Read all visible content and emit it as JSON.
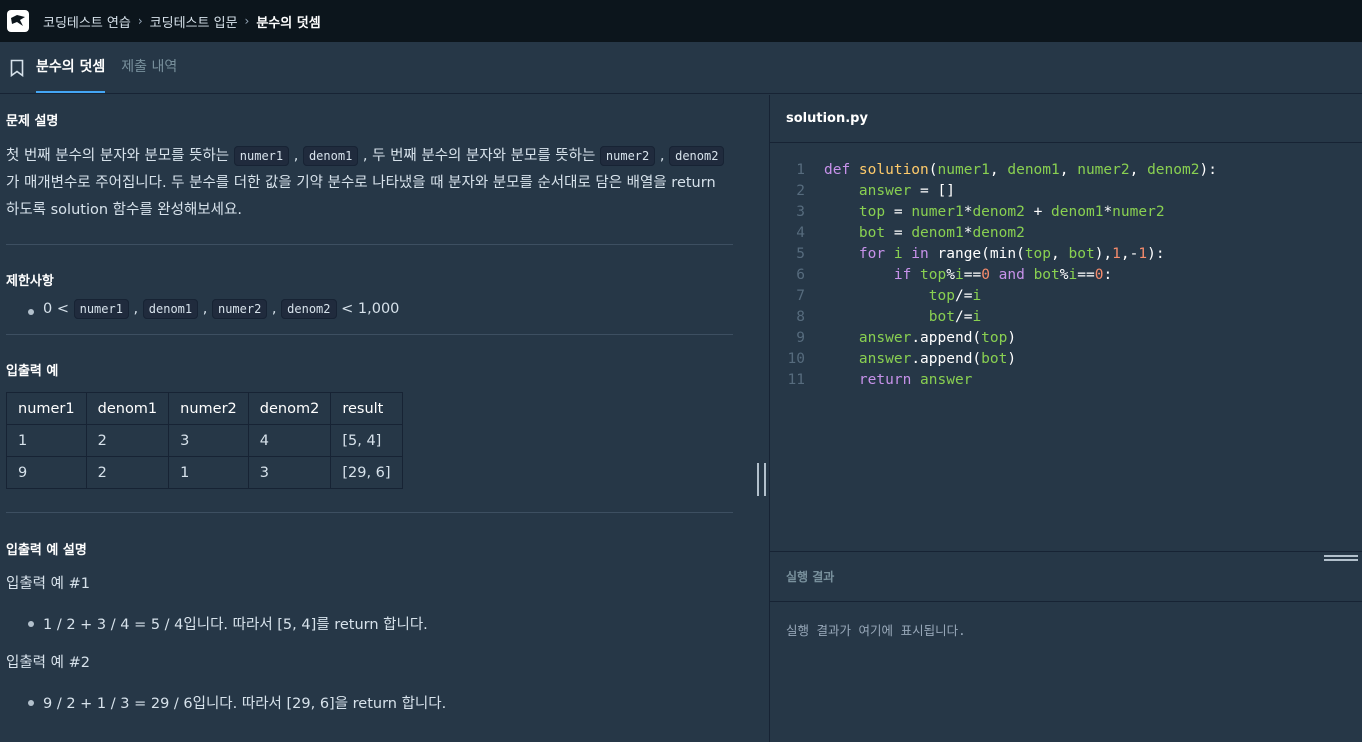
{
  "breadcrumb": [
    "코딩테스트 연습",
    "코딩테스트 입문",
    "분수의 덧셈"
  ],
  "tabs": {
    "active": "분수의 덧셈",
    "inactive": "제출 내역"
  },
  "problem": {
    "heading": "문제 설명",
    "desc": [
      {
        "t": "첫 번째 분수의 분자와 분모를 뜻하는 "
      },
      {
        "c": "numer1"
      },
      {
        "t": " , "
      },
      {
        "c": "denom1"
      },
      {
        "t": " , 두 번째 분수의 분자와 분모를 뜻하는 "
      },
      {
        "c": "numer2"
      },
      {
        "t": " , "
      },
      {
        "c": "denom2"
      },
      {
        "t": " 가 매개변수로 주어집니다. 두 분수를 더한 값을 기약 분수로 나타냈을 때 분자와 분모를 순서대로 담은 배열을 return 하도록 solution 함수를 완성해보세요."
      }
    ]
  },
  "constraints": {
    "heading": "제한사항",
    "item": [
      {
        "t": "0 < "
      },
      {
        "c": "numer1"
      },
      {
        "t": " , "
      },
      {
        "c": "denom1"
      },
      {
        "t": " , "
      },
      {
        "c": "numer2"
      },
      {
        "t": " , "
      },
      {
        "c": "denom2"
      },
      {
        "t": "  < 1,000"
      }
    ]
  },
  "examples": {
    "heading": "입출력 예",
    "columns": [
      "numer1",
      "denom1",
      "numer2",
      "denom2",
      "result"
    ],
    "rows": [
      [
        "1",
        "2",
        "3",
        "4",
        "[5, 4]"
      ],
      [
        "9",
        "2",
        "1",
        "3",
        "[29, 6]"
      ]
    ]
  },
  "explanation": {
    "heading": "입출력 예 설명",
    "items": [
      {
        "label": "입출력 예 #1",
        "text": "1 / 2 + 3 / 4 = 5 / 4입니다. 따라서 [5, 4]를 return 합니다."
      },
      {
        "label": "입출력 예 #2",
        "text": "9 / 2 + 1 / 3 = 29 / 6입니다. 따라서 [29, 6]을 return 합니다."
      }
    ]
  },
  "editor": {
    "filename": "solution.py",
    "lines": [
      [
        [
          "kw",
          "def "
        ],
        [
          "fn",
          "solution"
        ],
        [
          "op",
          "("
        ],
        [
          "id",
          "numer1"
        ],
        [
          "op",
          ", "
        ],
        [
          "id",
          "denom1"
        ],
        [
          "op",
          ", "
        ],
        [
          "id",
          "numer2"
        ],
        [
          "op",
          ", "
        ],
        [
          "id",
          "denom2"
        ],
        [
          "op",
          "):"
        ]
      ],
      [
        [
          "op",
          "    "
        ],
        [
          "id",
          "answer"
        ],
        [
          "op",
          " = []"
        ]
      ],
      [
        [
          "op",
          "    "
        ],
        [
          "id",
          "top"
        ],
        [
          "op",
          " = "
        ],
        [
          "id",
          "numer1"
        ],
        [
          "op",
          "*"
        ],
        [
          "id",
          "denom2"
        ],
        [
          "op",
          " + "
        ],
        [
          "id",
          "denom1"
        ],
        [
          "op",
          "*"
        ],
        [
          "id",
          "numer2"
        ]
      ],
      [
        [
          "op",
          "    "
        ],
        [
          "id",
          "bot"
        ],
        [
          "op",
          " = "
        ],
        [
          "id",
          "denom1"
        ],
        [
          "op",
          "*"
        ],
        [
          "id",
          "denom2"
        ]
      ],
      [
        [
          "op",
          "    "
        ],
        [
          "kw",
          "for "
        ],
        [
          "id",
          "i"
        ],
        [
          "kw",
          " in "
        ],
        [
          "op",
          "range(min("
        ],
        [
          "id",
          "top"
        ],
        [
          "op",
          ", "
        ],
        [
          "id",
          "bot"
        ],
        [
          "op",
          "),"
        ],
        [
          "num",
          "1"
        ],
        [
          "op",
          ",-"
        ],
        [
          "num",
          "1"
        ],
        [
          "op",
          "):"
        ]
      ],
      [
        [
          "op",
          "        "
        ],
        [
          "kw",
          "if "
        ],
        [
          "id",
          "top"
        ],
        [
          "op",
          "%"
        ],
        [
          "id",
          "i"
        ],
        [
          "op",
          "=="
        ],
        [
          "num",
          "0"
        ],
        [
          "kw",
          " and "
        ],
        [
          "id",
          "bot"
        ],
        [
          "op",
          "%"
        ],
        [
          "id",
          "i"
        ],
        [
          "op",
          "=="
        ],
        [
          "num",
          "0"
        ],
        [
          "op",
          ":"
        ]
      ],
      [
        [
          "op",
          "            "
        ],
        [
          "id",
          "top"
        ],
        [
          "op",
          "/="
        ],
        [
          "id",
          "i"
        ]
      ],
      [
        [
          "op",
          "            "
        ],
        [
          "id",
          "bot"
        ],
        [
          "op",
          "/="
        ],
        [
          "id",
          "i"
        ]
      ],
      [
        [
          "op",
          "    "
        ],
        [
          "id",
          "answer"
        ],
        [
          "op",
          ".append("
        ],
        [
          "id",
          "top"
        ],
        [
          "op",
          ")"
        ]
      ],
      [
        [
          "op",
          "    "
        ],
        [
          "id",
          "answer"
        ],
        [
          "op",
          ".append("
        ],
        [
          "id",
          "bot"
        ],
        [
          "op",
          ")"
        ]
      ],
      [
        [
          "op",
          "    "
        ],
        [
          "kw",
          "return "
        ],
        [
          "id",
          "answer"
        ]
      ]
    ]
  },
  "result": {
    "heading": "실행 결과",
    "placeholder": "실행 결과가 여기에 표시됩니다."
  }
}
